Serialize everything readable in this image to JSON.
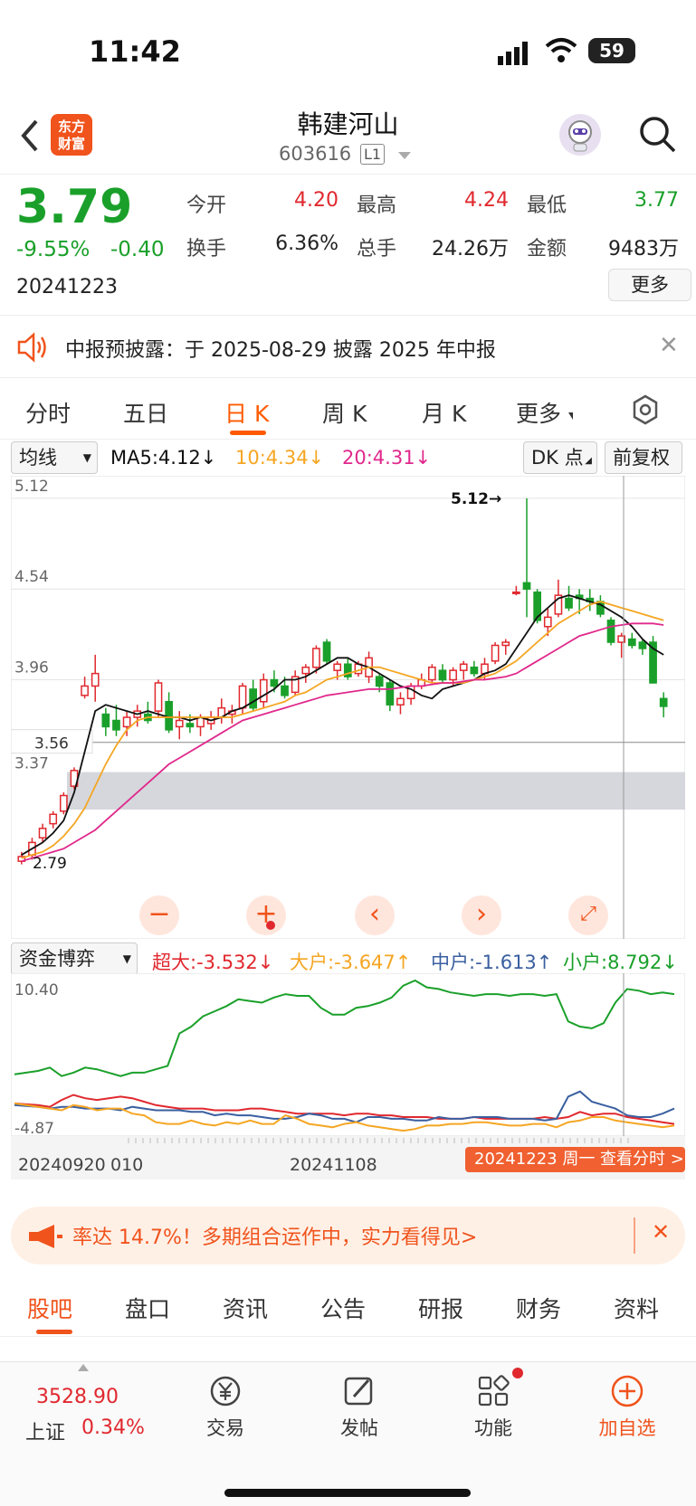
{
  "status": {
    "time": "11:42",
    "battery": "59"
  },
  "header": {
    "logo": "东方\n财富",
    "name": "韩建河山",
    "code": "603616",
    "level": "L1"
  },
  "quote": {
    "price": "3.79",
    "pct": "-9.55%",
    "chg": "-0.40",
    "date": "20241223",
    "fields": [
      [
        "今开",
        "4.20",
        "#e0282e"
      ],
      [
        "最高",
        "4.24",
        "#e0282e"
      ],
      [
        "最低",
        "3.77",
        "#1aa02a"
      ],
      [
        "换手",
        "6.36%",
        "#222"
      ],
      [
        "总手",
        "24.26万",
        "#222"
      ],
      [
        "金额",
        "9483万",
        "#222"
      ]
    ],
    "more": "更多"
  },
  "notice": {
    "text": "中报预披露：于 2025-08-29 披露 2025 年中报"
  },
  "tabs": [
    "分时",
    "五日",
    "日 K",
    "周 K",
    "月 K",
    "更多"
  ],
  "indicator": {
    "select": "均线",
    "ma5": "MA5:4.12↓",
    "ma10": "10:4.34↓",
    "ma20": "20:4.31↓",
    "dk": "DK 点",
    "adj": "前复权"
  },
  "kline": {
    "y_labels": [
      "5.12",
      "4.54",
      "3.96",
      "3.56",
      "3.37",
      "2.79"
    ],
    "high_marker": "5.12→",
    "low_marker": "2.79",
    "ohlc": [
      [
        2.8,
        2.86,
        2.78,
        2.83
      ],
      [
        2.84,
        2.95,
        2.81,
        2.92
      ],
      [
        2.95,
        3.04,
        2.92,
        3.01
      ],
      [
        3.04,
        3.12,
        3.01,
        3.1
      ],
      [
        3.12,
        3.24,
        3.1,
        3.22
      ],
      [
        3.28,
        3.4,
        3.26,
        3.38
      ],
      [
        3.86,
        3.98,
        3.84,
        3.92
      ],
      [
        3.92,
        4.12,
        3.82,
        4.0
      ],
      [
        3.74,
        3.78,
        3.6,
        3.66
      ],
      [
        3.7,
        3.8,
        3.6,
        3.64
      ],
      [
        3.66,
        3.76,
        3.6,
        3.72
      ],
      [
        3.72,
        3.8,
        3.66,
        3.76
      ],
      [
        3.74,
        3.82,
        3.68,
        3.7
      ],
      [
        3.76,
        3.96,
        3.72,
        3.94
      ],
      [
        3.82,
        3.88,
        3.62,
        3.64
      ],
      [
        3.66,
        3.76,
        3.58,
        3.7
      ],
      [
        3.68,
        3.74,
        3.62,
        3.66
      ],
      [
        3.66,
        3.74,
        3.6,
        3.72
      ],
      [
        3.68,
        3.76,
        3.64,
        3.72
      ],
      [
        3.72,
        3.84,
        3.68,
        3.78
      ],
      [
        3.74,
        3.8,
        3.68,
        3.76
      ],
      [
        3.78,
        3.94,
        3.74,
        3.92
      ],
      [
        3.9,
        3.96,
        3.76,
        3.78
      ],
      [
        3.82,
        4.0,
        3.78,
        3.96
      ],
      [
        3.96,
        4.02,
        3.88,
        3.92
      ],
      [
        3.92,
        3.98,
        3.84,
        3.86
      ],
      [
        3.88,
        4.02,
        3.86,
        3.98
      ],
      [
        4.0,
        4.06,
        3.94,
        4.04
      ],
      [
        4.04,
        4.18,
        4.0,
        4.16
      ],
      [
        4.2,
        4.22,
        4.06,
        4.08
      ],
      [
        4.02,
        4.08,
        3.96,
        4.06
      ],
      [
        4.06,
        4.1,
        3.96,
        3.98
      ],
      [
        4.0,
        4.08,
        3.98,
        4.06
      ],
      [
        3.98,
        4.14,
        3.94,
        4.1
      ],
      [
        3.98,
        4.0,
        3.88,
        3.92
      ],
      [
        3.94,
        3.96,
        3.76,
        3.8
      ],
      [
        3.8,
        3.88,
        3.74,
        3.84
      ],
      [
        3.84,
        3.94,
        3.8,
        3.92
      ],
      [
        3.92,
        4.0,
        3.9,
        3.96
      ],
      [
        3.96,
        4.06,
        3.94,
        4.04
      ],
      [
        4.02,
        4.06,
        3.94,
        3.96
      ],
      [
        3.96,
        4.04,
        3.92,
        4.02
      ],
      [
        4.02,
        4.08,
        3.96,
        4.06
      ],
      [
        4.04,
        4.08,
        3.98,
        4.0
      ],
      [
        4.0,
        4.1,
        3.96,
        4.06
      ],
      [
        4.08,
        4.2,
        4.06,
        4.18
      ],
      [
        4.18,
        4.22,
        4.12,
        4.2
      ],
      [
        4.52,
        4.56,
        4.5,
        4.52
      ],
      [
        4.58,
        5.12,
        4.36,
        4.54
      ],
      [
        4.52,
        4.54,
        4.32,
        4.34
      ],
      [
        4.3,
        4.42,
        4.24,
        4.36
      ],
      [
        4.38,
        4.6,
        4.36,
        4.5
      ],
      [
        4.48,
        4.56,
        4.4,
        4.42
      ],
      [
        4.5,
        4.54,
        4.38,
        4.48
      ],
      [
        4.48,
        4.54,
        4.4,
        4.46
      ],
      [
        4.46,
        4.5,
        4.36,
        4.38
      ],
      [
        4.34,
        4.36,
        4.18,
        4.2
      ],
      [
        4.2,
        4.26,
        4.1,
        4.24
      ],
      [
        4.22,
        4.26,
        4.16,
        4.18
      ],
      [
        4.2,
        4.22,
        4.12,
        4.16
      ],
      [
        4.2,
        4.24,
        3.96,
        3.94
      ],
      [
        3.84,
        3.88,
        3.72,
        3.79
      ]
    ],
    "ma5": [
      2.84,
      2.88,
      2.92,
      2.98,
      3.06,
      3.24,
      3.5,
      3.76,
      3.8,
      3.78,
      3.76,
      3.74,
      3.76,
      3.74,
      3.72,
      3.72,
      3.7,
      3.72,
      3.7,
      3.72,
      3.76,
      3.78,
      3.82,
      3.86,
      3.9,
      3.96,
      3.96,
      3.98,
      4.02,
      4.06,
      4.1,
      4.1,
      4.06,
      4.04,
      4.0,
      3.96,
      3.92,
      3.9,
      3.86,
      3.84,
      3.9,
      3.92,
      3.94,
      3.96,
      4.0,
      4.02,
      4.06,
      4.16,
      4.26,
      4.36,
      4.42,
      4.48,
      4.5,
      4.48,
      4.46,
      4.44,
      4.4,
      4.36,
      4.3,
      4.22,
      4.16,
      4.12
    ],
    "ma10": [
      2.82,
      2.84,
      2.86,
      2.9,
      2.96,
      3.04,
      3.14,
      3.28,
      3.42,
      3.54,
      3.64,
      3.7,
      3.72,
      3.72,
      3.72,
      3.72,
      3.72,
      3.72,
      3.72,
      3.72,
      3.72,
      3.74,
      3.76,
      3.78,
      3.8,
      3.82,
      3.86,
      3.88,
      3.92,
      3.96,
      3.98,
      4.0,
      4.02,
      4.04,
      4.04,
      4.02,
      4.0,
      3.98,
      3.96,
      3.94,
      3.94,
      3.94,
      3.94,
      3.96,
      3.98,
      4.0,
      4.04,
      4.08,
      4.14,
      4.2,
      4.26,
      4.32,
      4.36,
      4.4,
      4.44,
      4.46,
      4.44,
      4.42,
      4.4,
      4.38,
      4.36,
      4.34
    ],
    "ma20": [
      2.8,
      2.82,
      2.84,
      2.86,
      2.88,
      2.92,
      2.96,
      3.0,
      3.06,
      3.12,
      3.18,
      3.24,
      3.3,
      3.36,
      3.42,
      3.46,
      3.5,
      3.54,
      3.58,
      3.62,
      3.66,
      3.7,
      3.72,
      3.74,
      3.76,
      3.78,
      3.8,
      3.82,
      3.84,
      3.86,
      3.87,
      3.88,
      3.89,
      3.9,
      3.9,
      3.9,
      3.91,
      3.92,
      3.92,
      3.93,
      3.94,
      3.94,
      3.95,
      3.96,
      3.96,
      3.97,
      3.98,
      4.0,
      4.04,
      4.08,
      4.12,
      4.16,
      4.2,
      4.24,
      4.26,
      4.28,
      4.3,
      4.31,
      4.32,
      4.32,
      4.32,
      4.31
    ]
  },
  "fund": {
    "select": "资金博弈",
    "s1": "超大:-3.532↓",
    "s2": "大户:-3.647↑",
    "s3": "中户:-1.613↑",
    "s4": "小户:8.792↓",
    "ymax": "10.40",
    "ymin": "-4.87",
    "dates": [
      "20240920",
      "010",
      "20241108"
    ],
    "tooltip": "20241223 周一 查看分时 >",
    "small": [
      -0.6,
      -0.4,
      -0.2,
      0.2,
      -0.8,
      -0.4,
      0.2,
      0,
      -0.4,
      -0.8,
      -0.4,
      -0.4,
      0,
      0.4,
      4.2,
      5,
      6.2,
      6.8,
      7.4,
      8.2,
      8.0,
      7.8,
      8.4,
      8.8,
      8.6,
      8.6,
      7.2,
      6.4,
      6.4,
      7.2,
      7.4,
      7.8,
      8.4,
      9.8,
      10.4,
      9.6,
      9.4,
      9.0,
      8.8,
      8.6,
      8.8,
      8.8,
      8.6,
      8.8,
      8.8,
      8.6,
      8.8,
      5.6,
      5.0,
      4.8,
      5.4,
      7.8,
      9.4,
      9.2,
      8.8,
      9.0,
      8.8
    ],
    "super": [
      -4.0,
      -4.1,
      -4.2,
      -4.4,
      -3.6,
      -3.0,
      -3.4,
      -3.6,
      -3.4,
      -3.2,
      -3.4,
      -3.8,
      -4.2,
      -4.4,
      -4.6,
      -4.6,
      -4.6,
      -4.8,
      -4.8,
      -4.8,
      -4.6,
      -4.6,
      -4.8,
      -5.0,
      -5.2,
      -5.2,
      -5.2,
      -5.2,
      -5.4,
      -5.2,
      -5.2,
      -5.4,
      -5.4,
      -5.6,
      -5.6,
      -5.6,
      -5.8,
      -5.8,
      -5.8,
      -5.6,
      -5.8,
      -5.8,
      -5.8,
      -5.8,
      -5.8,
      -5.6,
      -5.8,
      -5.6,
      -5.0,
      -5.4,
      -5.2,
      -5.2,
      -5.6,
      -5.8,
      -6.0,
      -6.2,
      -6.4
    ],
    "mid": [
      -4.2,
      -4.3,
      -4.4,
      -4.6,
      -4.4,
      -4.4,
      -4.6,
      -4.6,
      -4.6,
      -4.8,
      -4.4,
      -4.6,
      -4.8,
      -4.8,
      -4.8,
      -5.0,
      -5.0,
      -5.4,
      -5.2,
      -5.4,
      -5.4,
      -5.6,
      -5.8,
      -5.8,
      -5.6,
      -5.2,
      -5.4,
      -5.8,
      -5.8,
      -6.2,
      -5.6,
      -5.6,
      -5.8,
      -5.8,
      -6.0,
      -6.0,
      -5.6,
      -5.8,
      -5.8,
      -5.6,
      -5.6,
      -5.6,
      -5.8,
      -5.8,
      -5.8,
      -6.0,
      -5.8,
      -3.2,
      -2.6,
      -3.8,
      -4.2,
      -4.6,
      -5.4,
      -5.6,
      -5.6,
      -5.2,
      -4.6
    ],
    "big": [
      -4.0,
      -4.2,
      -4.4,
      -4.6,
      -4.8,
      -4.2,
      -4.4,
      -4.8,
      -4.6,
      -4.6,
      -5.2,
      -5.4,
      -6.2,
      -6.4,
      -6.4,
      -6.0,
      -6.4,
      -6.6,
      -6.2,
      -6.4,
      -6.0,
      -6.4,
      -6.4,
      -5.4,
      -5.8,
      -6.4,
      -6.6,
      -6.8,
      -6.4,
      -6.2,
      -6.6,
      -6.8,
      -7.0,
      -7.2,
      -7.0,
      -6.6,
      -6.6,
      -6.4,
      -6.4,
      -6.2,
      -6.2,
      -6.4,
      -6.6,
      -6.6,
      -6.4,
      -6.4,
      -6.8,
      -6.2,
      -6.0,
      -5.6,
      -5.6,
      -6.0,
      -6.2,
      -6.4,
      -6.6,
      -6.8,
      -6.6
    ]
  },
  "banner": {
    "text": "率达 14.7%！多期组合运作中，实力看得见>"
  },
  "btabs": [
    "股吧",
    "盘口",
    "资讯",
    "公告",
    "研报",
    "财务",
    "资料"
  ],
  "bottom": {
    "index_val": "3528.90",
    "index_name": "上证",
    "index_pct": "0.34%",
    "trade": "交易",
    "post": "发帖",
    "func": "功能",
    "add": "加自选"
  },
  "colors": {
    "up": "#e0282e",
    "down": "#1aa02a",
    "ma5": "#111111",
    "ma10": "#f5a623",
    "ma20": "#e0288c",
    "accent": "#ff5a00"
  }
}
